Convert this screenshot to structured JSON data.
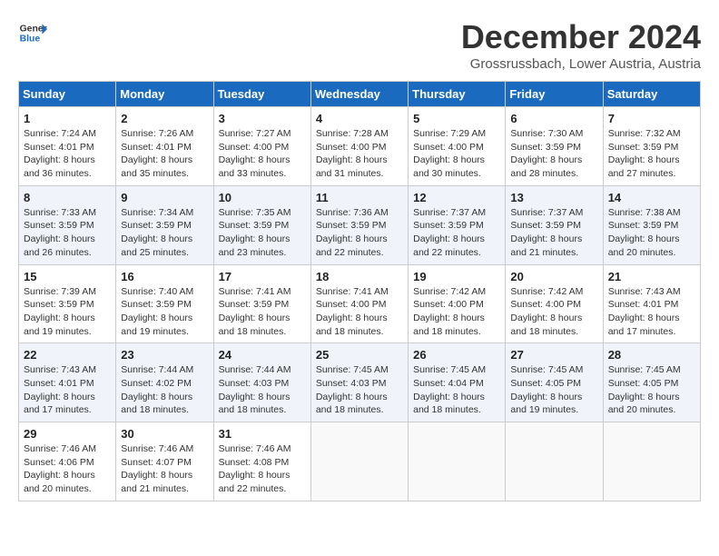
{
  "header": {
    "logo_line1": "General",
    "logo_line2": "Blue",
    "month_title": "December 2024",
    "location": "Grossrussbach, Lower Austria, Austria"
  },
  "weekdays": [
    "Sunday",
    "Monday",
    "Tuesday",
    "Wednesday",
    "Thursday",
    "Friday",
    "Saturday"
  ],
  "weeks": [
    [
      {
        "day": "1",
        "sunrise": "7:24 AM",
        "sunset": "4:01 PM",
        "daylight": "8 hours and 36 minutes."
      },
      {
        "day": "2",
        "sunrise": "7:26 AM",
        "sunset": "4:01 PM",
        "daylight": "8 hours and 35 minutes."
      },
      {
        "day": "3",
        "sunrise": "7:27 AM",
        "sunset": "4:00 PM",
        "daylight": "8 hours and 33 minutes."
      },
      {
        "day": "4",
        "sunrise": "7:28 AM",
        "sunset": "4:00 PM",
        "daylight": "8 hours and 31 minutes."
      },
      {
        "day": "5",
        "sunrise": "7:29 AM",
        "sunset": "4:00 PM",
        "daylight": "8 hours and 30 minutes."
      },
      {
        "day": "6",
        "sunrise": "7:30 AM",
        "sunset": "3:59 PM",
        "daylight": "8 hours and 28 minutes."
      },
      {
        "day": "7",
        "sunrise": "7:32 AM",
        "sunset": "3:59 PM",
        "daylight": "8 hours and 27 minutes."
      }
    ],
    [
      {
        "day": "8",
        "sunrise": "7:33 AM",
        "sunset": "3:59 PM",
        "daylight": "8 hours and 26 minutes."
      },
      {
        "day": "9",
        "sunrise": "7:34 AM",
        "sunset": "3:59 PM",
        "daylight": "8 hours and 25 minutes."
      },
      {
        "day": "10",
        "sunrise": "7:35 AM",
        "sunset": "3:59 PM",
        "daylight": "8 hours and 23 minutes."
      },
      {
        "day": "11",
        "sunrise": "7:36 AM",
        "sunset": "3:59 PM",
        "daylight": "8 hours and 22 minutes."
      },
      {
        "day": "12",
        "sunrise": "7:37 AM",
        "sunset": "3:59 PM",
        "daylight": "8 hours and 22 minutes."
      },
      {
        "day": "13",
        "sunrise": "7:37 AM",
        "sunset": "3:59 PM",
        "daylight": "8 hours and 21 minutes."
      },
      {
        "day": "14",
        "sunrise": "7:38 AM",
        "sunset": "3:59 PM",
        "daylight": "8 hours and 20 minutes."
      }
    ],
    [
      {
        "day": "15",
        "sunrise": "7:39 AM",
        "sunset": "3:59 PM",
        "daylight": "8 hours and 19 minutes."
      },
      {
        "day": "16",
        "sunrise": "7:40 AM",
        "sunset": "3:59 PM",
        "daylight": "8 hours and 19 minutes."
      },
      {
        "day": "17",
        "sunrise": "7:41 AM",
        "sunset": "3:59 PM",
        "daylight": "8 hours and 18 minutes."
      },
      {
        "day": "18",
        "sunrise": "7:41 AM",
        "sunset": "4:00 PM",
        "daylight": "8 hours and 18 minutes."
      },
      {
        "day": "19",
        "sunrise": "7:42 AM",
        "sunset": "4:00 PM",
        "daylight": "8 hours and 18 minutes."
      },
      {
        "day": "20",
        "sunrise": "7:42 AM",
        "sunset": "4:00 PM",
        "daylight": "8 hours and 18 minutes."
      },
      {
        "day": "21",
        "sunrise": "7:43 AM",
        "sunset": "4:01 PM",
        "daylight": "8 hours and 17 minutes."
      }
    ],
    [
      {
        "day": "22",
        "sunrise": "7:43 AM",
        "sunset": "4:01 PM",
        "daylight": "8 hours and 17 minutes."
      },
      {
        "day": "23",
        "sunrise": "7:44 AM",
        "sunset": "4:02 PM",
        "daylight": "8 hours and 18 minutes."
      },
      {
        "day": "24",
        "sunrise": "7:44 AM",
        "sunset": "4:03 PM",
        "daylight": "8 hours and 18 minutes."
      },
      {
        "day": "25",
        "sunrise": "7:45 AM",
        "sunset": "4:03 PM",
        "daylight": "8 hours and 18 minutes."
      },
      {
        "day": "26",
        "sunrise": "7:45 AM",
        "sunset": "4:04 PM",
        "daylight": "8 hours and 18 minutes."
      },
      {
        "day": "27",
        "sunrise": "7:45 AM",
        "sunset": "4:05 PM",
        "daylight": "8 hours and 19 minutes."
      },
      {
        "day": "28",
        "sunrise": "7:45 AM",
        "sunset": "4:05 PM",
        "daylight": "8 hours and 20 minutes."
      }
    ],
    [
      {
        "day": "29",
        "sunrise": "7:46 AM",
        "sunset": "4:06 PM",
        "daylight": "8 hours and 20 minutes."
      },
      {
        "day": "30",
        "sunrise": "7:46 AM",
        "sunset": "4:07 PM",
        "daylight": "8 hours and 21 minutes."
      },
      {
        "day": "31",
        "sunrise": "7:46 AM",
        "sunset": "4:08 PM",
        "daylight": "8 hours and 22 minutes."
      },
      null,
      null,
      null,
      null
    ]
  ]
}
